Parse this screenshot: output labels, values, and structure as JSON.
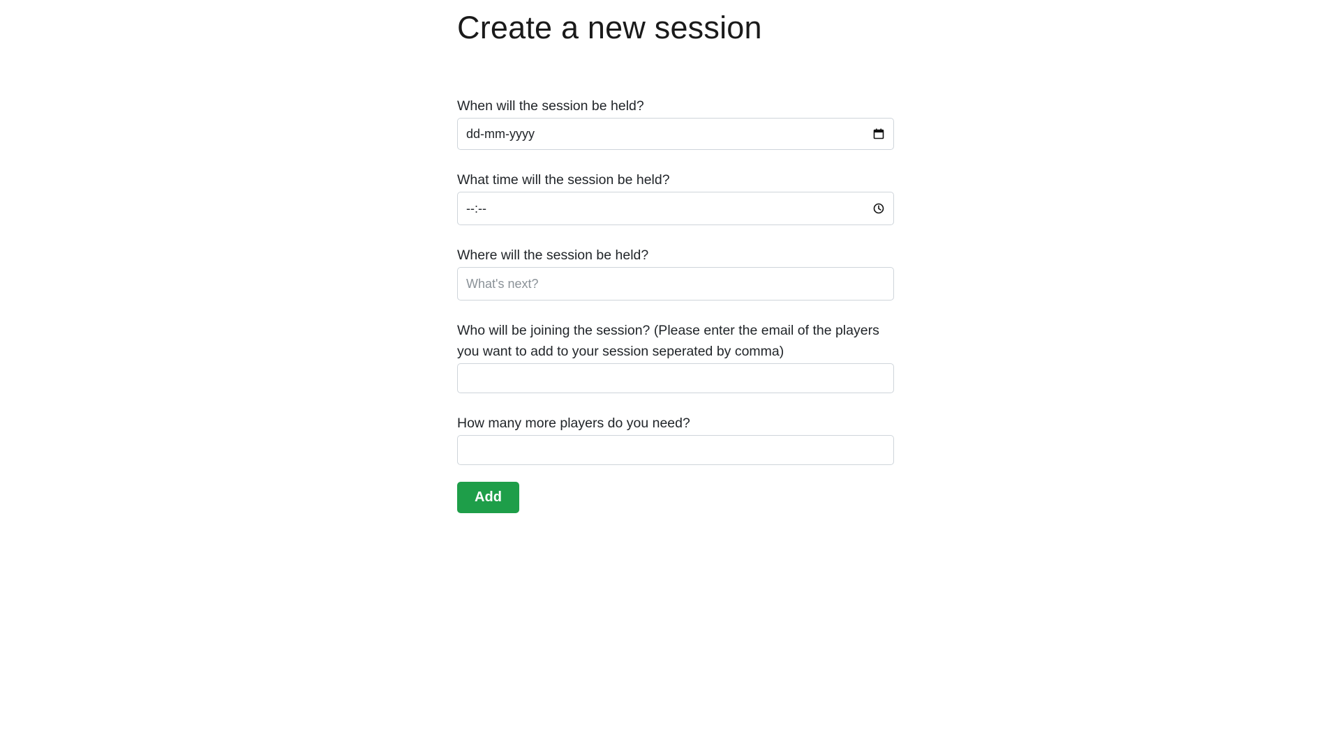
{
  "page": {
    "title": "Create a new session"
  },
  "form": {
    "date": {
      "label": "When will the session be held?",
      "value": "dd-mm-yyyy",
      "icon": "calendar-icon"
    },
    "time": {
      "label": "What time will the session be held?",
      "value": "--:--",
      "icon": "clock-icon"
    },
    "location": {
      "label": "Where will the session be held?",
      "placeholder": "What's next?",
      "value": ""
    },
    "players": {
      "label": "Who will be joining the session? (Please enter the email of the players you want to add to your session seperated by comma)",
      "value": ""
    },
    "more_players": {
      "label": "How many more players do you need?",
      "value": ""
    },
    "submit_label": "Add"
  },
  "colors": {
    "accent": "#1e9e49",
    "border": "#ced4da",
    "placeholder": "#8b9298"
  }
}
